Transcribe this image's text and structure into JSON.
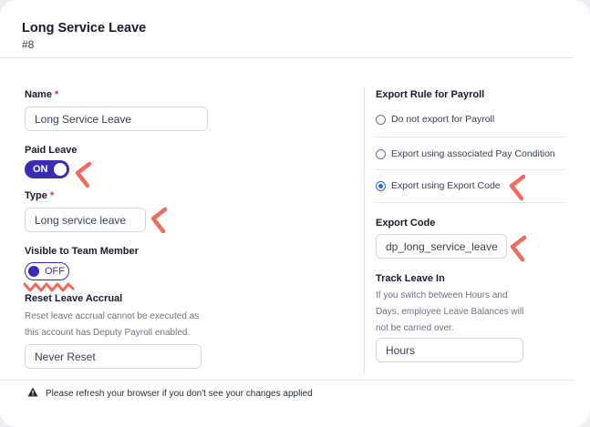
{
  "header": {
    "title": "Long Service Leave",
    "subtitle": "#8"
  },
  "form": {
    "name": {
      "label": "Name",
      "required_mark": "*",
      "value": "Long Service Leave"
    },
    "paid_leave": {
      "label": "Paid Leave",
      "state": "ON"
    },
    "type": {
      "label": "Type",
      "required_mark": "*",
      "value": "Long service leave"
    },
    "visible_to_team_member": {
      "label": "Visible to Team Member",
      "state": "OFF"
    },
    "reset_leave_accrual": {
      "label": "Reset Leave Accrual",
      "help_line1": "Reset leave accrual cannot be executed as",
      "help_line2": "this account has Deputy Payroll enabled.",
      "value": "Never Reset"
    }
  },
  "export": {
    "label": "Export Rule for Payroll",
    "options": [
      {
        "label": "Do not export for Payroll",
        "selected": false
      },
      {
        "label": "Export using associated Pay Condition",
        "selected": false
      },
      {
        "label": "Export using Export Code",
        "selected": true
      }
    ],
    "code_label": "Export Code",
    "code_value": "dp_long_service_leave",
    "track_label": "Track Leave In",
    "track_help_line1": "If you switch between Hours and",
    "track_help_line2": "Days, employee Leave Balances will",
    "track_help_line3": "not be carried over.",
    "track_value": "Hours"
  },
  "footer": {
    "message": "Please refresh your browser if you don't see your changes applied",
    "icon": "warning-icon"
  },
  "colors": {
    "toggle": "#3a2bb3",
    "required": "#e2255a",
    "annotation": "#f26a5c",
    "radio_selected": "#2563eb"
  }
}
